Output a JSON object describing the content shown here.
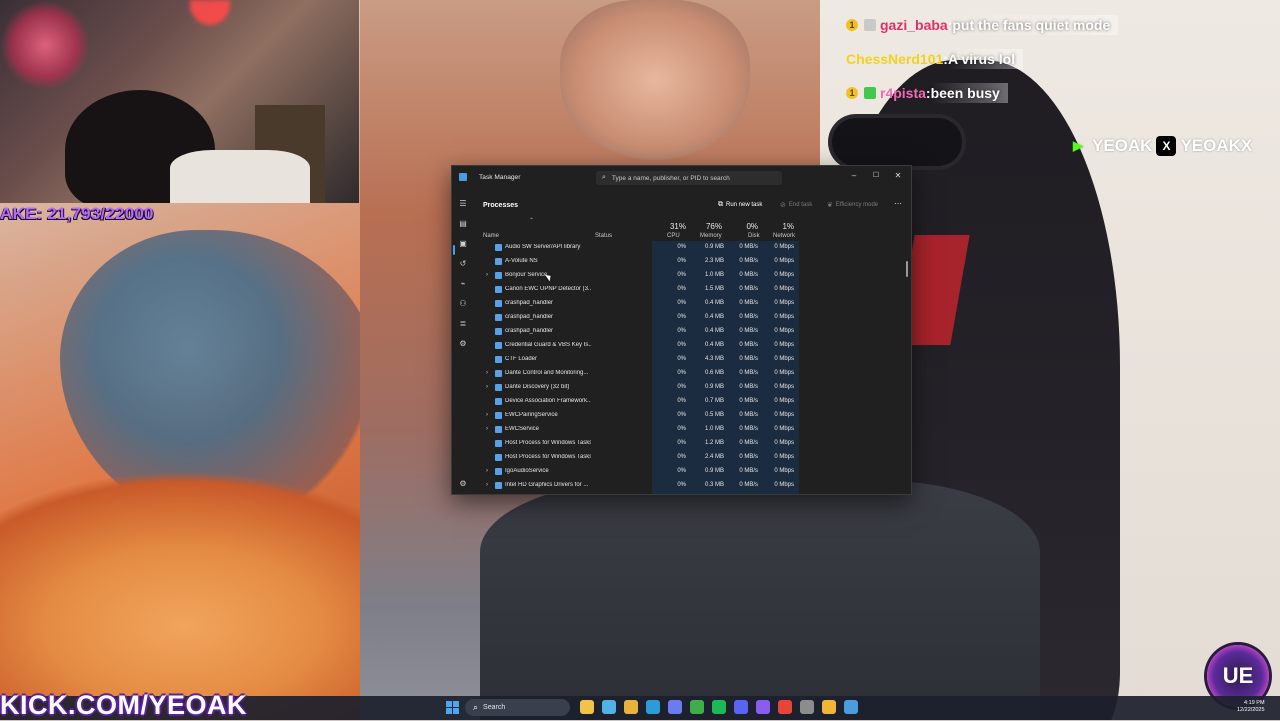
{
  "stream_overlay": {
    "subgoal_text": "AKE: 21,793/22000",
    "kick_banner": "KICK.COM/YEOAK",
    "socials": [
      {
        "icon": "kick-icon",
        "handle": "YEOAK",
        "color": "#53fc18"
      },
      {
        "icon": "x-icon",
        "handle": "YEOAKX",
        "color": "#000000"
      }
    ],
    "ue_badge": "UE"
  },
  "chat": [
    {
      "badge": "1",
      "username": "gazi_baba",
      "username_color": "#e0306a",
      "message": "put the fans quiet mode"
    },
    {
      "badge": "",
      "username": "ChessNerd101",
      "username_color": "#f2d21b",
      "message": "A virus lol"
    },
    {
      "badge": "1",
      "username": "r4pista",
      "username_color": "#f26bb0",
      "message": "been busy"
    }
  ],
  "task_manager": {
    "title": "Task Manager",
    "search_placeholder": "Type a name, publisher, or PID to search",
    "heading": "Processes",
    "toolbar": {
      "run_new_task": "Run new task",
      "end_task": "End task",
      "efficiency_mode": "Efficiency mode",
      "more": "⋯"
    },
    "window_buttons": {
      "minimize": "–",
      "maximize": "☐",
      "close": "✕"
    },
    "columns": {
      "name": "Name",
      "status": "Status",
      "cpu": {
        "label": "CPU",
        "percent": "31%"
      },
      "memory": {
        "label": "Memory",
        "percent": "76%"
      },
      "disk": {
        "label": "Disk",
        "percent": "0%"
      },
      "network": {
        "label": "Network",
        "percent": "1%"
      }
    },
    "rows": [
      {
        "name": "Audio SW Server/API library",
        "expandable": false,
        "cpu": "0%",
        "memory": "0.9 MB",
        "disk": "0 MB/s",
        "network": "0 Mbps"
      },
      {
        "name": "A-Volute NS",
        "expandable": false,
        "cpu": "0%",
        "memory": "2.3 MB",
        "disk": "0 MB/s",
        "network": "0 Mbps"
      },
      {
        "name": "Bonjour Service",
        "expandable": true,
        "cpu": "0%",
        "memory": "1.0 MB",
        "disk": "0 MB/s",
        "network": "0 Mbps"
      },
      {
        "name": "Canon EWC UPNP Detector (3...",
        "expandable": false,
        "cpu": "0%",
        "memory": "1.5 MB",
        "disk": "0 MB/s",
        "network": "0 Mbps"
      },
      {
        "name": "crashpad_handler",
        "expandable": false,
        "cpu": "0%",
        "memory": "0.4 MB",
        "disk": "0 MB/s",
        "network": "0 Mbps"
      },
      {
        "name": "crashpad_handler",
        "expandable": false,
        "cpu": "0%",
        "memory": "0.4 MB",
        "disk": "0 MB/s",
        "network": "0 Mbps"
      },
      {
        "name": "crashpad_handler",
        "expandable": false,
        "cpu": "0%",
        "memory": "0.4 MB",
        "disk": "0 MB/s",
        "network": "0 Mbps"
      },
      {
        "name": "Credential Guard & VBS Key Is...",
        "expandable": false,
        "cpu": "0%",
        "memory": "0.4 MB",
        "disk": "0 MB/s",
        "network": "0 Mbps"
      },
      {
        "name": "CTF Loader",
        "expandable": false,
        "cpu": "0%",
        "memory": "4.3 MB",
        "disk": "0 MB/s",
        "network": "0 Mbps"
      },
      {
        "name": "Dante Control and Monitoring...",
        "expandable": true,
        "cpu": "0%",
        "memory": "0.6 MB",
        "disk": "0 MB/s",
        "network": "0 Mbps"
      },
      {
        "name": "Dante Discovery (32 bit)",
        "expandable": true,
        "cpu": "0%",
        "memory": "0.9 MB",
        "disk": "0 MB/s",
        "network": "0 Mbps"
      },
      {
        "name": "Device Association Framework...",
        "expandable": false,
        "cpu": "0%",
        "memory": "0.7 MB",
        "disk": "0 MB/s",
        "network": "0 Mbps"
      },
      {
        "name": "EWCPairingService",
        "expandable": true,
        "cpu": "0%",
        "memory": "0.5 MB",
        "disk": "0 MB/s",
        "network": "0 Mbps"
      },
      {
        "name": "EWCService",
        "expandable": true,
        "cpu": "0%",
        "memory": "1.0 MB",
        "disk": "0 MB/s",
        "network": "0 Mbps"
      },
      {
        "name": "Host Process for Windows Tasks",
        "expandable": false,
        "cpu": "0%",
        "memory": "1.2 MB",
        "disk": "0 MB/s",
        "network": "0 Mbps"
      },
      {
        "name": "Host Process for Windows Tasks",
        "expandable": false,
        "cpu": "0%",
        "memory": "2.4 MB",
        "disk": "0 MB/s",
        "network": "0 Mbps"
      },
      {
        "name": "IgoAudioService",
        "expandable": true,
        "cpu": "0%",
        "memory": "0.9 MB",
        "disk": "0 MB/s",
        "network": "0 Mbps"
      },
      {
        "name": "Intel HD Graphics Drivers for ...",
        "expandable": true,
        "cpu": "0%",
        "memory": "0.3 MB",
        "disk": "0 MB/s",
        "network": "0 Mbps"
      }
    ]
  },
  "taskbar": {
    "search_label": "Search",
    "clock_time": "4:19 PM",
    "clock_date": "12/22/2025",
    "apps": [
      {
        "icon": "file-explorer-icon",
        "color": "#f3c248"
      },
      {
        "icon": "copilot-icon",
        "color": "#4fb3e8"
      },
      {
        "icon": "folder-icon",
        "color": "#e9b23c"
      },
      {
        "icon": "edge-icon",
        "color": "#2c9bd8"
      },
      {
        "icon": "store-icon",
        "color": "#6b7cf0"
      },
      {
        "icon": "xbox-icon",
        "color": "#3fae4a"
      },
      {
        "icon": "spotify-icon",
        "color": "#1db954"
      },
      {
        "icon": "discord-icon",
        "color": "#5865f2"
      },
      {
        "icon": "obs-icon",
        "color": "#8a5cf0"
      },
      {
        "icon": "chrome-icon",
        "color": "#e6463a"
      },
      {
        "icon": "settings-icon",
        "color": "#8c8c8c"
      },
      {
        "icon": "chrome-alt-icon",
        "color": "#f0b43a"
      },
      {
        "icon": "task-manager-icon",
        "color": "#4a9be0"
      }
    ]
  }
}
